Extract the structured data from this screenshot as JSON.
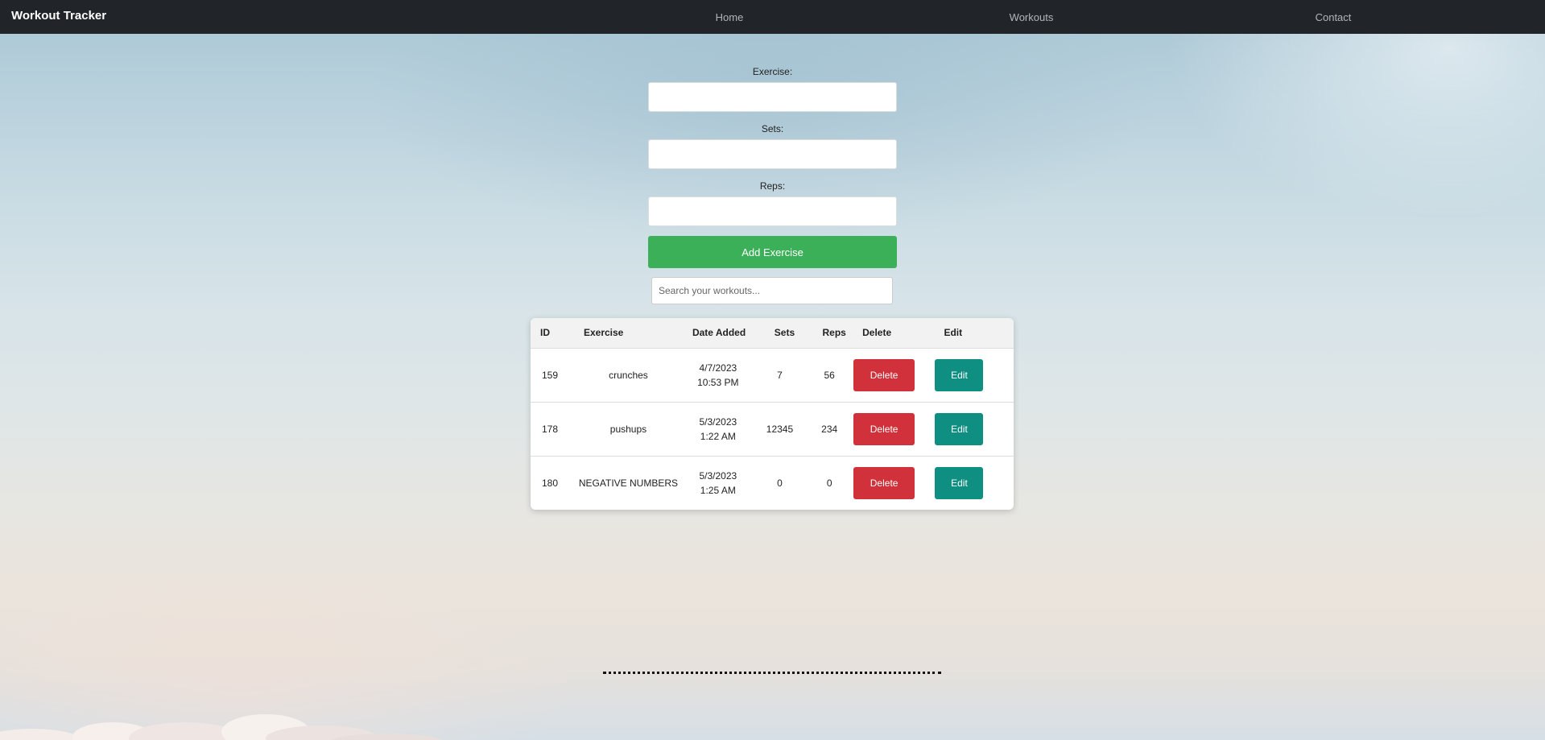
{
  "navbar": {
    "brand": "Workout Tracker",
    "links": [
      "Home",
      "Workouts",
      "Contact"
    ]
  },
  "form": {
    "exercise_label": "Exercise:",
    "sets_label": "Sets:",
    "reps_label": "Reps:",
    "exercise_value": "",
    "sets_value": "",
    "reps_value": "",
    "add_button": "Add Exercise"
  },
  "search": {
    "placeholder": "Search your workouts..."
  },
  "table": {
    "headers": [
      "ID",
      "Exercise",
      "Date Added",
      "Sets",
      "Reps",
      "Delete",
      "Edit"
    ],
    "rows": [
      {
        "id": "159",
        "exercise": "crunches",
        "date": "4/7/2023",
        "time": "10:53 PM",
        "sets": "7",
        "reps": "56",
        "delete": "Delete",
        "edit": "Edit"
      },
      {
        "id": "178",
        "exercise": "pushups",
        "date": "5/3/2023",
        "time": "1:22 AM",
        "sets": "12345",
        "reps": "234",
        "delete": "Delete",
        "edit": "Edit"
      },
      {
        "id": "180",
        "exercise": "NEGATIVE NUMBERS",
        "date": "5/3/2023",
        "time": "1:25 AM",
        "sets": "0",
        "reps": "0",
        "delete": "Delete",
        "edit": "Edit"
      }
    ]
  },
  "colors": {
    "navbar": "#212529",
    "add_button": "#3bb058",
    "delete_button": "#d0313a",
    "edit_button": "#0f8f82"
  }
}
